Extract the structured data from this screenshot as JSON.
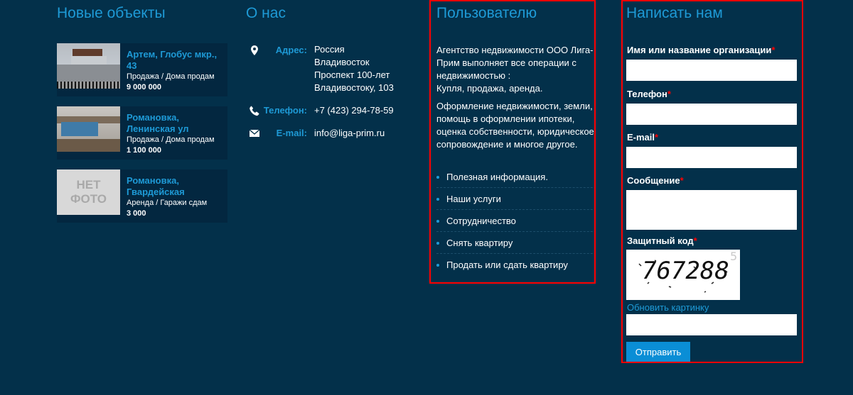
{
  "new_objects": {
    "title": "Новые объекты",
    "items": [
      {
        "title": "Артем, Глобус мкр., 43",
        "category": "Продажа / Дома продам",
        "price": "9 000 000"
      },
      {
        "title": "Романовка, Ленинская ул",
        "category": "Продажа / Дома продам",
        "price": "1 100 000"
      },
      {
        "title": "Романовка, Гвардейская",
        "category": "Аренда / Гаражи сдам",
        "price": "3 000",
        "photo_placeholder": "НЕТ ФОТО"
      }
    ]
  },
  "about": {
    "title": "О нас",
    "address_label": "Адрес:",
    "address_lines": [
      "Россия",
      "Владивосток",
      "Проспект 100-лет",
      "Владивостоку, 103"
    ],
    "phone_label": "Телефон:",
    "phone": "+7 (423) 294-78-59",
    "email_label": "E-mail:",
    "email": "info@liga-prim.ru"
  },
  "user": {
    "title": "Пользователю",
    "paragraph1_lines": [
      "Агентство недвижимости ООО Лига-",
      "Прим выполняет все операции с",
      "недвижимостью :",
      "Купля, продажа, аренда."
    ],
    "paragraph2_lines": [
      "Оформление недвижимости, земли,",
      "помощь в оформлении ипотеки,",
      "оценка собственности, юридическое",
      "сопровождение и многое другое."
    ],
    "links": [
      "Полезная информация.",
      "Наши услуги",
      "Сотрудничество",
      "Снять квартиру",
      "Продать или сдать квартиру"
    ]
  },
  "contact_form": {
    "title": "Написать нам",
    "required_mark": "*",
    "name_label": "Имя или название организации",
    "phone_label": "Телефон",
    "email_label": "E-mail",
    "message_label": "Сообщение",
    "captcha_label": "Защитный код",
    "captcha_text": "767288",
    "captcha_extra": "5",
    "refresh_link": "Обновить картинку",
    "submit_label": "Отправить"
  },
  "colors": {
    "background": "#03304a",
    "accent": "#1e9ad6",
    "highlight_border": "#ff0000",
    "button": "#0a8ed6"
  },
  "icons": [
    "map-pin-icon",
    "phone-icon",
    "envelope-icon"
  ]
}
